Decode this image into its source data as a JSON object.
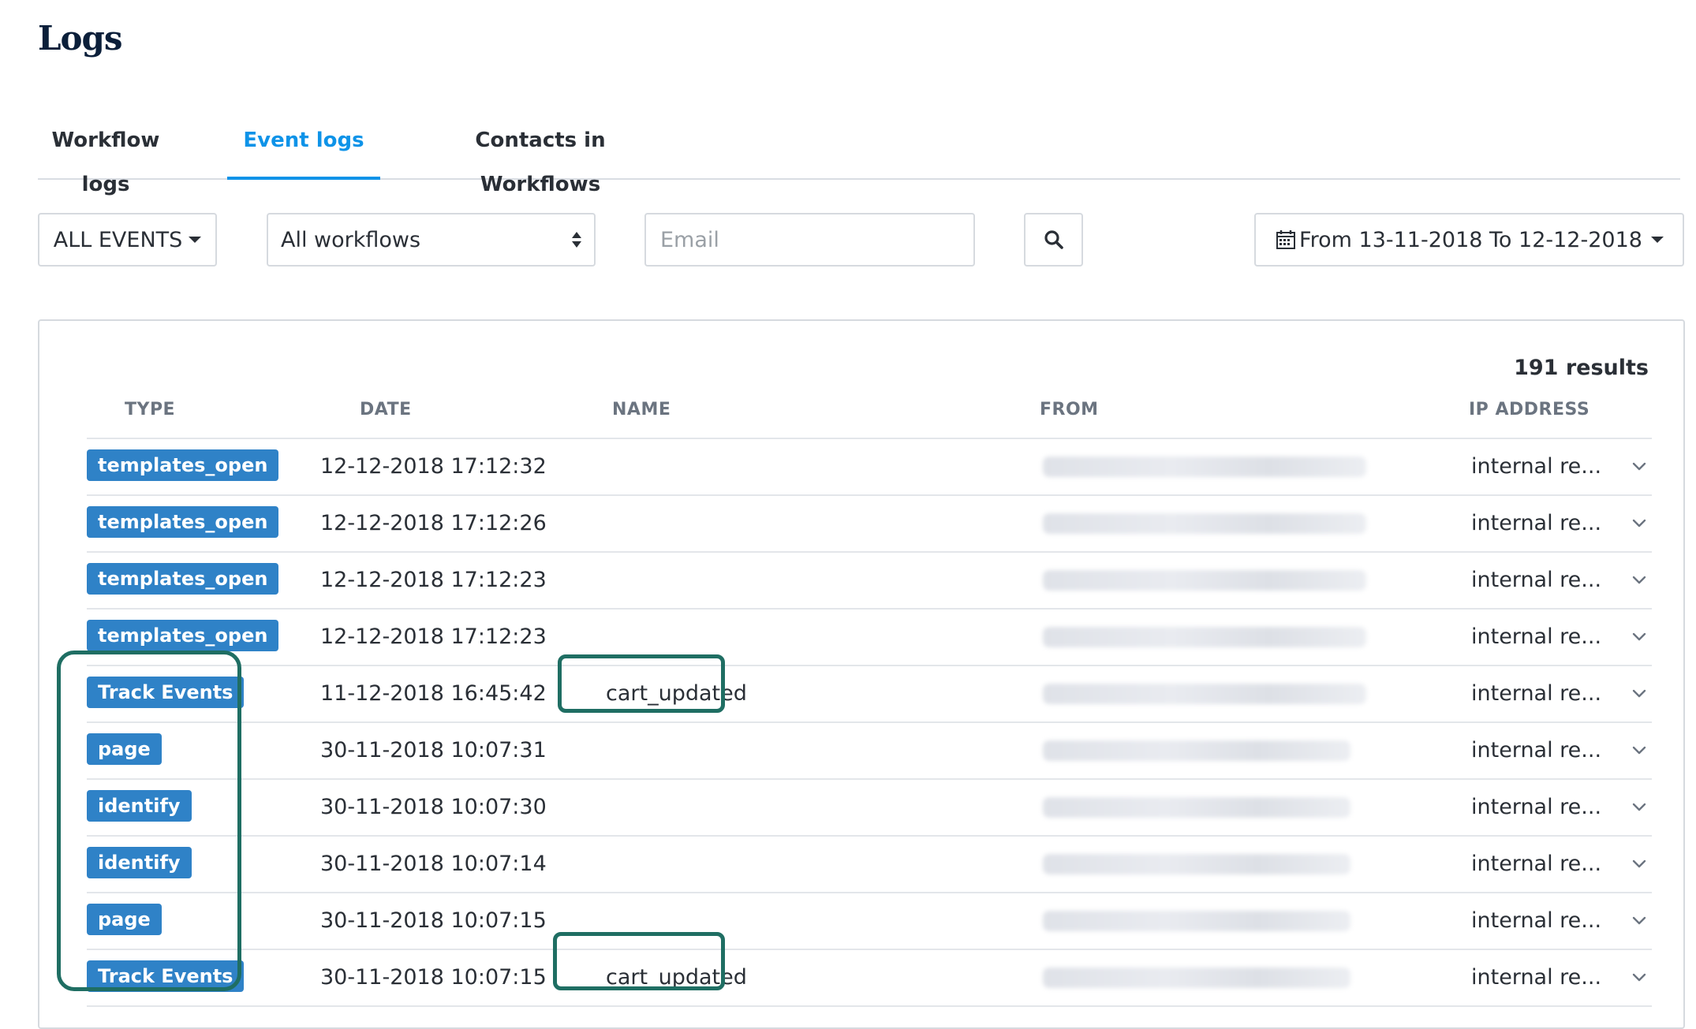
{
  "page": {
    "title": "Logs"
  },
  "tabs": [
    {
      "label": "Workflow logs",
      "active": false
    },
    {
      "label": "Event logs",
      "active": true
    },
    {
      "label": "Contacts in Workflows",
      "active": false
    }
  ],
  "filters": {
    "events_label": "ALL EVENTS",
    "workflow_value": "All workflows",
    "email_placeholder": "Email",
    "date_range": "From 13-11-2018 To 12-12-2018"
  },
  "results_label": "191 results",
  "table": {
    "headers": [
      "TYPE",
      "DATE",
      "NAME",
      "FROM",
      "IP ADDRESS"
    ],
    "rows": [
      {
        "type": "templates_open",
        "date": "12-12-2018 17:12:32",
        "name": "",
        "ip": "internal re..."
      },
      {
        "type": "templates_open",
        "date": "12-12-2018 17:12:26",
        "name": "",
        "ip": "internal re..."
      },
      {
        "type": "templates_open",
        "date": "12-12-2018 17:12:23",
        "name": "",
        "ip": "internal re..."
      },
      {
        "type": "templates_open",
        "date": "12-12-2018 17:12:23",
        "name": "",
        "ip": "internal re..."
      },
      {
        "type": "Track Events",
        "date": "11-12-2018 16:45:42",
        "name": "cart_updated",
        "ip": "internal re..."
      },
      {
        "type": "page",
        "date": "30-11-2018 10:07:31",
        "name": "",
        "ip": "internal re..."
      },
      {
        "type": "identify",
        "date": "30-11-2018 10:07:30",
        "name": "",
        "ip": "internal re..."
      },
      {
        "type": "identify",
        "date": "30-11-2018 10:07:14",
        "name": "",
        "ip": "internal re..."
      },
      {
        "type": "page",
        "date": "30-11-2018 10:07:15",
        "name": "",
        "ip": "internal re..."
      },
      {
        "type": "Track Events",
        "date": "30-11-2018 10:07:15",
        "name": "cart_updated",
        "ip": "internal re..."
      }
    ]
  },
  "colors": {
    "accent": "#0e93e8",
    "badge": "#2f82c7",
    "highlight": "#1f6e63"
  }
}
